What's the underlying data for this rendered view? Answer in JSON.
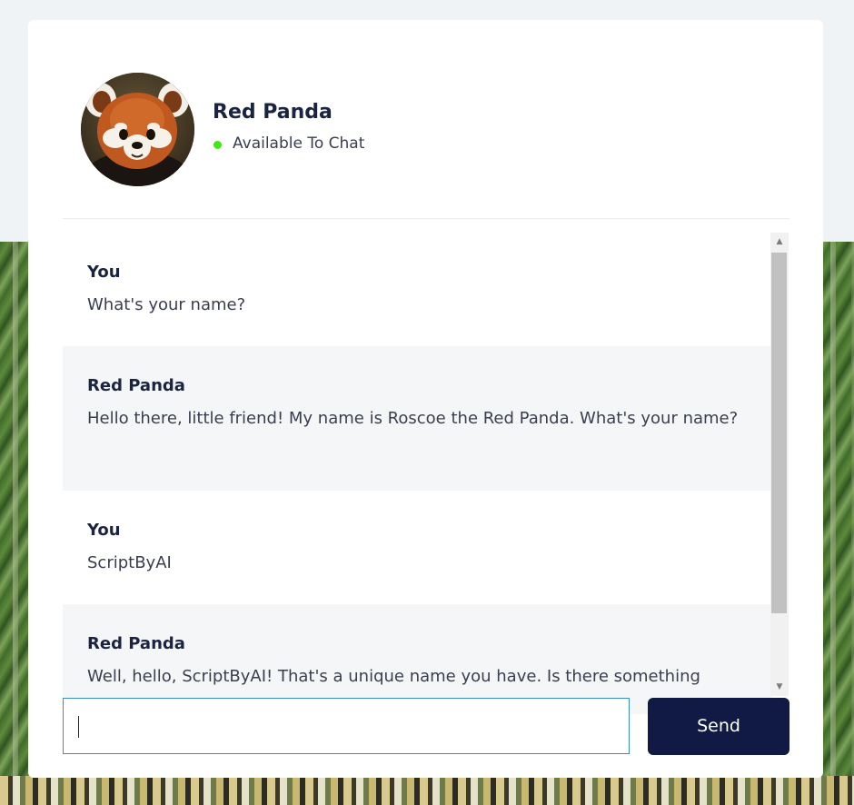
{
  "contact": {
    "name": "Red Panda",
    "status": "Available To Chat",
    "status_color": "#3bea11"
  },
  "messages": [
    {
      "author": "You",
      "text": "What's your name?"
    },
    {
      "author": "Red Panda",
      "text": "Hello there, little friend! My name is Roscoe the Red Panda. What's your name?"
    },
    {
      "author": "You",
      "text": "ScriptByAI"
    },
    {
      "author": "Red Panda",
      "text": "Well, hello, ScriptByAI! That's a unique name you have. Is there something"
    }
  ],
  "composer": {
    "input_value": "",
    "send_label": "Send"
  },
  "colors": {
    "accent": "#111a45",
    "input_border": "#3a8ad0",
    "bot_bubble": "#f5f6f7"
  }
}
